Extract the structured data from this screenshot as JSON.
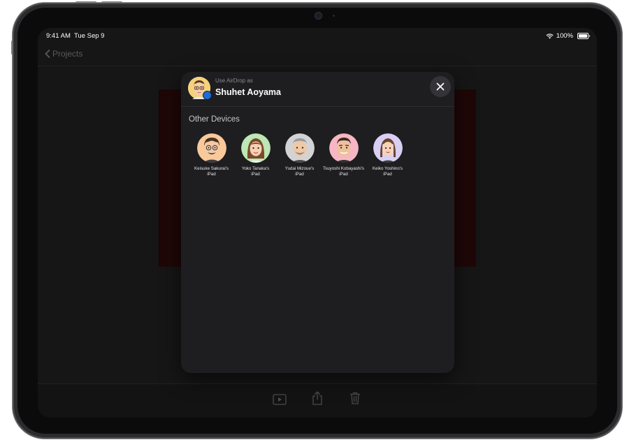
{
  "status": {
    "time": "9:41 AM",
    "date": "Tue Sep 9",
    "battery": "100%"
  },
  "nav": {
    "back_label": "Projects"
  },
  "airdrop": {
    "use_as": "Use AirDrop as",
    "user_name": "Shuhet Aoyama",
    "section_title": "Other Devices",
    "devices": [
      {
        "name_line1": "Keisuke Sakurai's",
        "name_line2": "iPad",
        "avatar_color": "#f9c99a"
      },
      {
        "name_line1": "Yoko Tanaka's",
        "name_line2": "iPad",
        "avatar_color": "#bde7b4"
      },
      {
        "name_line1": "Yudai Mizoue's",
        "name_line2": "iPad",
        "avatar_color": "#d3d3d6"
      },
      {
        "name_line1": "Tsuyoshi Kobayashi's",
        "name_line2": "iPad",
        "avatar_color": "#f6b6c3"
      },
      {
        "name_line1": "Keiko Yoshino's",
        "name_line2": "iPad",
        "avatar_color": "#d9cff3"
      }
    ]
  },
  "icons": {
    "wifi": "wifi-icon",
    "battery": "battery-icon",
    "back": "chevron-left-icon",
    "close": "close-icon",
    "play": "play-icon",
    "share": "share-icon",
    "trash": "trash-icon"
  }
}
